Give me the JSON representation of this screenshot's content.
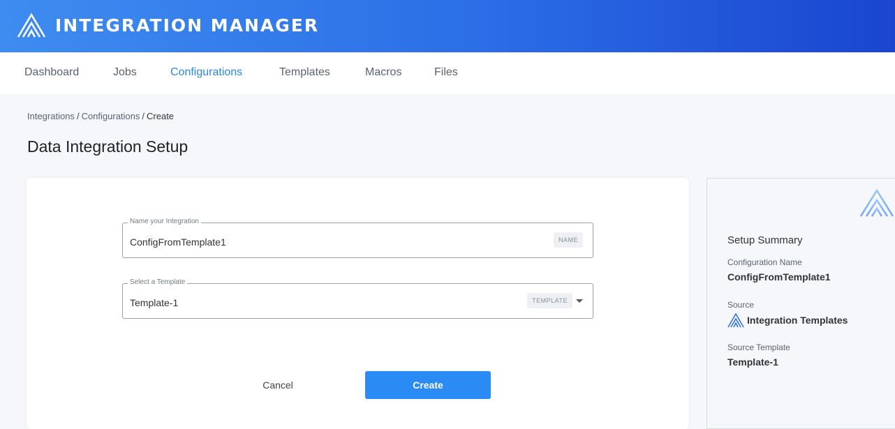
{
  "header": {
    "title": "INTEGRATION MANAGER",
    "logo_icon": "peak-logo-icon"
  },
  "nav": {
    "items": [
      {
        "label": "Dashboard",
        "active": false
      },
      {
        "label": "Jobs",
        "active": false
      },
      {
        "label": "Configurations",
        "active": true
      },
      {
        "label": "Templates",
        "active": false
      },
      {
        "label": "Macros",
        "active": false
      },
      {
        "label": "Files",
        "active": false
      }
    ]
  },
  "breadcrumb": {
    "items": [
      "Integrations",
      "Configurations"
    ],
    "current": "Create",
    "separator": "/"
  },
  "page": {
    "title": "Data Integration Setup"
  },
  "form": {
    "name_field": {
      "label": "Name your Integration",
      "value": "ConfigFromTemplate1",
      "chip": "NAME"
    },
    "template_field": {
      "label": "Select a Template",
      "value": "Template-1",
      "chip": "TEMPLATE"
    },
    "cancel_label": "Cancel",
    "create_label": "Create"
  },
  "summary": {
    "title": "Setup Summary",
    "config_name_label": "Configuration Name",
    "config_name_value": "ConfigFromTemplate1",
    "source_label": "Source",
    "source_value": "Integration Templates",
    "source_template_label": "Source Template",
    "source_template_value": "Template-1"
  },
  "colors": {
    "accent": "#2b8bf5",
    "header_start": "#3e8cf0",
    "header_end": "#1a45d0"
  }
}
